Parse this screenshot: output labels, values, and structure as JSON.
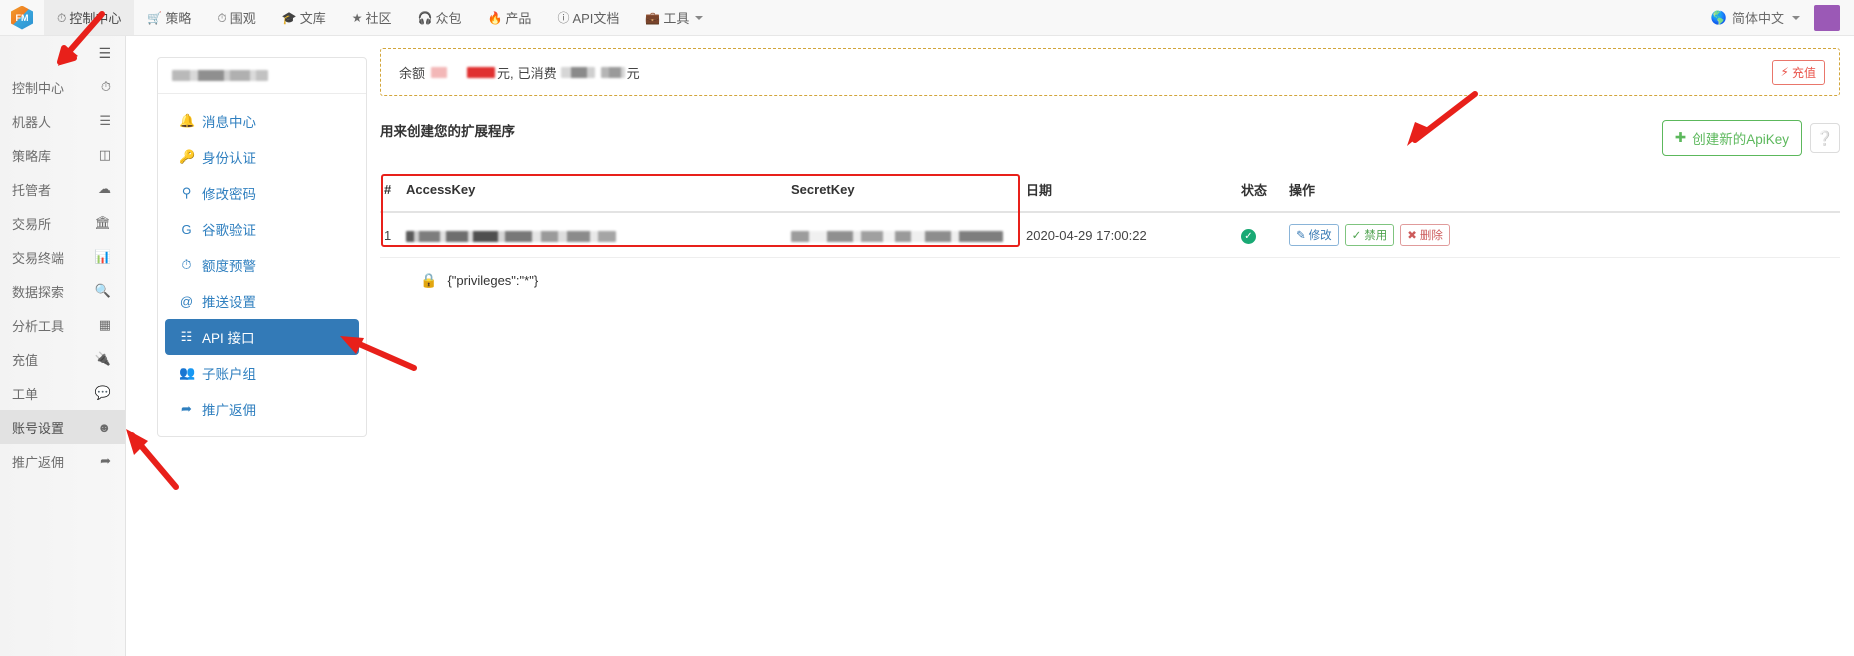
{
  "topnav": {
    "brand_alt": "logo",
    "items": [
      {
        "label": "控制中心",
        "icon": "dashboard-clock-icon",
        "active": true
      },
      {
        "label": "策略",
        "icon": "cart-icon",
        "active": false
      },
      {
        "label": "围观",
        "icon": "clock-icon",
        "active": false
      },
      {
        "label": "文库",
        "icon": "graduation-cap-icon",
        "active": false
      },
      {
        "label": "社区",
        "icon": "star-icon",
        "active": false
      },
      {
        "label": "众包",
        "icon": "headphones-icon",
        "active": false
      },
      {
        "label": "产品",
        "icon": "fire-icon",
        "active": false
      },
      {
        "label": "API文档",
        "icon": "info-circle-icon",
        "active": false
      },
      {
        "label": "工具",
        "icon": "briefcase-icon",
        "active": false,
        "caret": true
      }
    ],
    "language": "简体中文",
    "language_icon": "globe-icon",
    "avatar_color": "#9b59b6"
  },
  "rail": {
    "toggle_icon": "hamburger-icon",
    "items": [
      {
        "label": "控制中心",
        "icon": "speedometer-icon",
        "selected": false
      },
      {
        "label": "机器人",
        "icon": "robot-list-icon",
        "selected": false
      },
      {
        "label": "策略库",
        "icon": "cube-icon",
        "selected": false
      },
      {
        "label": "托管者",
        "icon": "cloud-icon",
        "selected": false
      },
      {
        "label": "交易所",
        "icon": "bank-icon",
        "selected": false
      },
      {
        "label": "交易终端",
        "icon": "bar-chart-icon",
        "selected": false
      },
      {
        "label": "数据探索",
        "icon": "search-plus-icon",
        "selected": false
      },
      {
        "label": "分析工具",
        "icon": "table-icon",
        "selected": false
      },
      {
        "label": "充值",
        "icon": "plug-icon",
        "selected": false
      },
      {
        "label": "工单",
        "icon": "comment-icon",
        "selected": false
      },
      {
        "label": "账号设置",
        "icon": "user-circle-icon",
        "selected": true
      },
      {
        "label": "推广返佣",
        "icon": "share-icon",
        "selected": false
      }
    ]
  },
  "submenu": {
    "account_name_redacted": true,
    "items": [
      {
        "label": "消息中心",
        "icon": "bell-icon",
        "active": false
      },
      {
        "label": "身份认证",
        "icon": "id-badge-icon",
        "active": false
      },
      {
        "label": "修改密码",
        "icon": "key-icon",
        "active": false
      },
      {
        "label": "谷歌验证",
        "icon": "google-g-icon",
        "active": false
      },
      {
        "label": "额度预警",
        "icon": "clock-icon",
        "active": false
      },
      {
        "label": "推送设置",
        "icon": "at-icon",
        "active": false
      },
      {
        "label": "API 接口",
        "icon": "sitemap-icon",
        "active": true
      },
      {
        "label": "子账户组",
        "icon": "users-icon",
        "active": false
      },
      {
        "label": "推广返佣",
        "icon": "share-alt-icon",
        "active": false
      }
    ]
  },
  "balance": {
    "prefix": "余额",
    "unit1": "元,",
    "spent_label": "已消费",
    "unit2": "元",
    "redacted": true,
    "recharge_label": "充值",
    "recharge_icon": "bolt-icon"
  },
  "content": {
    "section_title": "用来创建您的扩展程序",
    "create_button": "创建新的ApiKey",
    "create_icon": "plus-icon",
    "help_icon": "question-circle-icon"
  },
  "table": {
    "headers": [
      "#",
      "AccessKey",
      "SecretKey",
      "日期",
      "状态",
      "操作"
    ],
    "rows": [
      {
        "index": "1",
        "accesskey": "",
        "secretkey": "",
        "date": "2020-04-29 17:00:22",
        "status_icon": "check-circle-icon",
        "status_color": "#19a974",
        "actions": [
          {
            "label": "修改",
            "icon": "edit-icon",
            "kind": "edit"
          },
          {
            "label": "禁用",
            "icon": "ban-check-icon",
            "kind": "ban"
          },
          {
            "label": "删除",
            "icon": "delete-circle-icon",
            "kind": "del"
          }
        ]
      }
    ],
    "privileges_text": "{\"privileges\":\"*\"}",
    "privileges_icon": "lock-icon"
  },
  "annotations": {
    "accent_color": "#e8201a",
    "arrow_count": 4,
    "highlight_box": "table-header-and-row"
  }
}
